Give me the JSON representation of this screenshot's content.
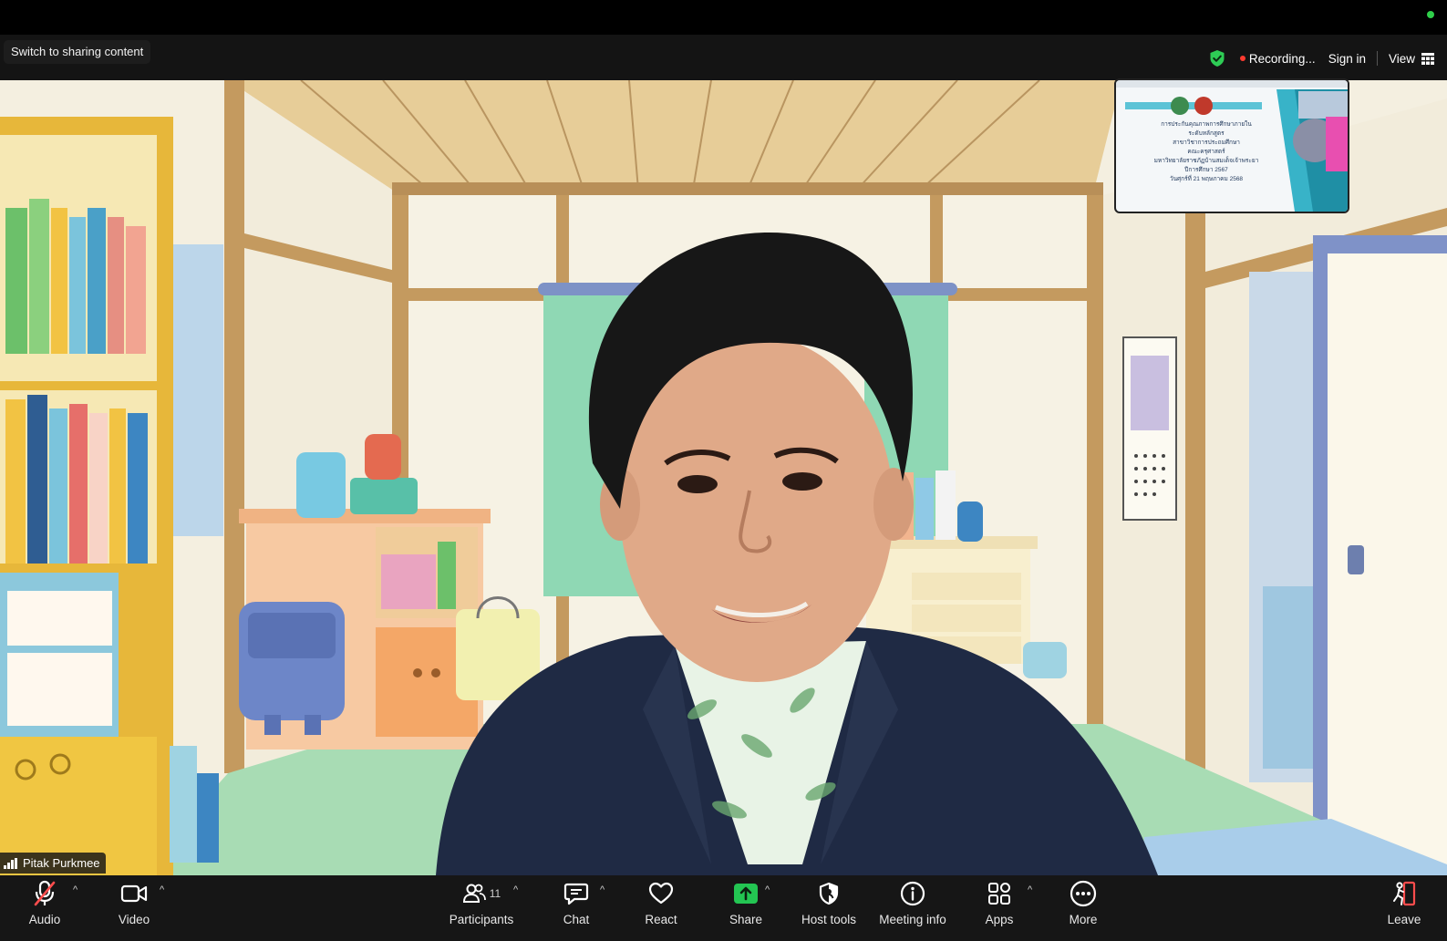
{
  "topbar": {
    "switch_label": "Switch to sharing content",
    "recording_label": "Recording...",
    "sign_in_label": "Sign in",
    "view_label": "View",
    "icons": [
      "shield-check-icon",
      "recording-dot-icon",
      "grid-view-icon"
    ],
    "colors": {
      "shield": "#2ecc55",
      "recording_dot": "#ff3b30"
    }
  },
  "video": {
    "participant_name": "Pitak Purkmee",
    "background": "cartoon-bedroom"
  },
  "thumbnail": {
    "content": "shared-slide",
    "slide_lines": [
      "การประกันคุณภาพการศึกษาภายใน",
      "ระดับหลักสูตร",
      "สาขาวิชาการประถมศึกษา",
      "คณะครุศาสตร์",
      "มหาวิทยาลัยราชภัฏบ้านสมเด็จเจ้าพระยา",
      "ปีการศึกษา 2567",
      "วันศุกร์ที่ 21 พฤษภาคม 2568"
    ]
  },
  "toolbar": {
    "audio_label": "Audio",
    "video_label": "Video",
    "participants_label": "Participants",
    "participants_count": "11",
    "chat_label": "Chat",
    "react_label": "React",
    "share_label": "Share",
    "host_tools_label": "Host tools",
    "meeting_info_label": "Meeting info",
    "apps_label": "Apps",
    "more_label": "More",
    "leave_label": "Leave",
    "caret_symbol": "^",
    "colors": {
      "share": "#23c552",
      "muted": "#ff4d4d",
      "leave": "#ff4d4d"
    }
  }
}
